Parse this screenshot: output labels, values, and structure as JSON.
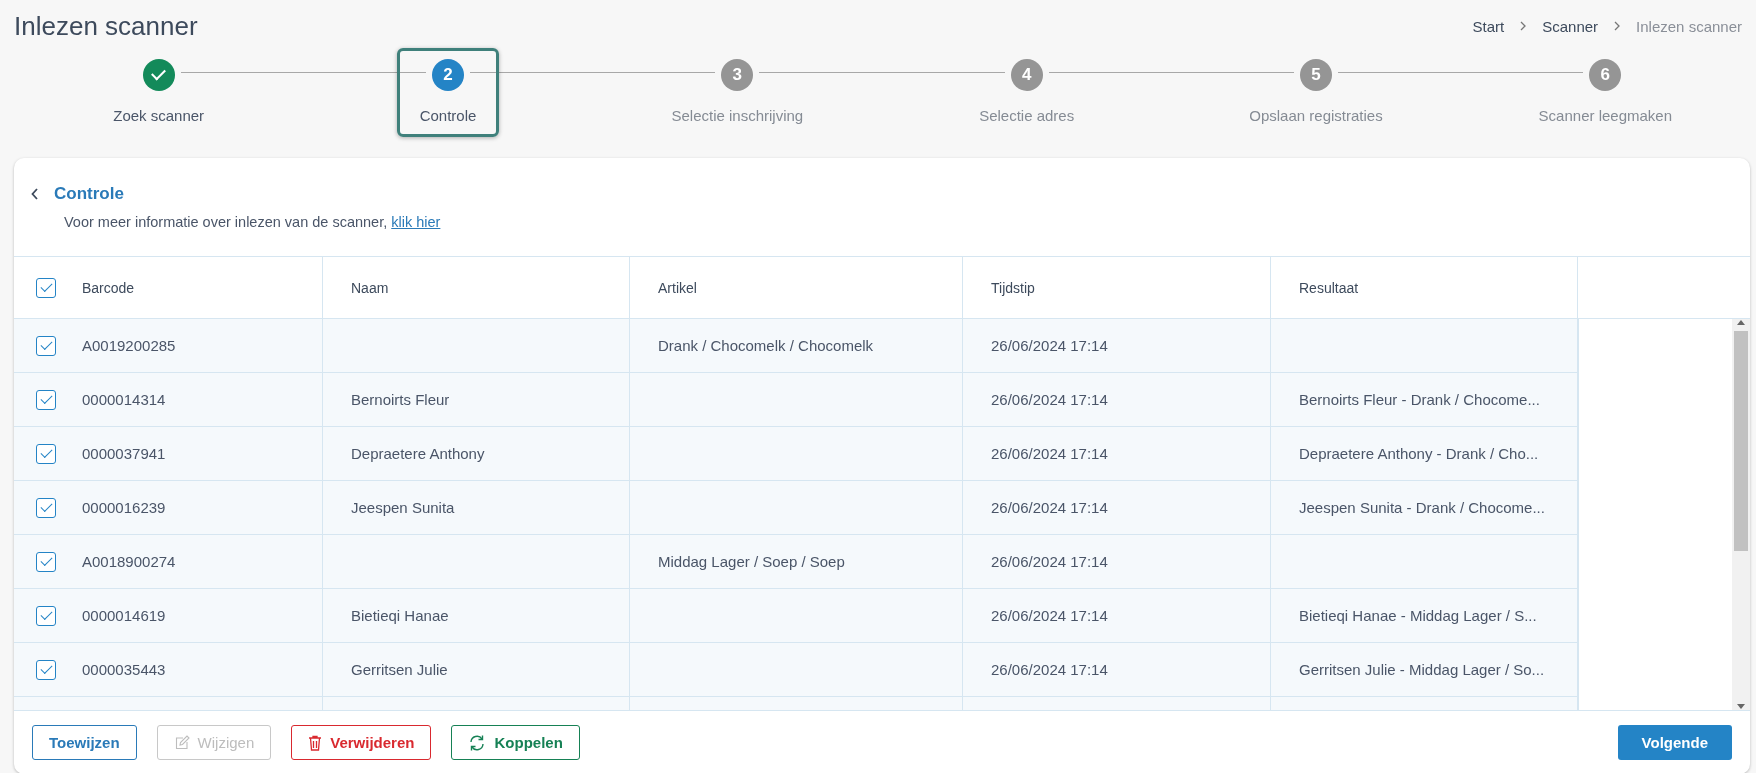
{
  "page": {
    "title": "Inlezen scanner"
  },
  "breadcrumb": [
    {
      "label": "Start",
      "current": false
    },
    {
      "label": "Scanner",
      "current": false
    },
    {
      "label": "Inlezen scanner",
      "current": true
    }
  ],
  "steps": [
    {
      "label": "Zoek scanner",
      "completed": true,
      "selected": false
    },
    {
      "label": "Controle",
      "number": "2",
      "completed": false,
      "selected": true
    },
    {
      "label": "Selectie inschrijving",
      "number": "3",
      "completed": false,
      "selected": false
    },
    {
      "label": "Selectie adres",
      "number": "4",
      "completed": false,
      "selected": false
    },
    {
      "label": "Opslaan registraties",
      "number": "5",
      "completed": false,
      "selected": false
    },
    {
      "label": "Scanner leegmaken",
      "number": "6",
      "completed": false,
      "selected": false
    }
  ],
  "card": {
    "title": "Controle",
    "info": "Voor meer informatie over inlezen van de scanner, ",
    "info_link": "klik hier"
  },
  "table": {
    "select_all_checked": true,
    "columns": [
      "Barcode",
      "Naam",
      "Artikel",
      "Tijdstip",
      "Resultaat"
    ],
    "rows": [
      {
        "checked": true,
        "cells": [
          "A0019200285",
          "",
          "Drank / Chocomelk / Chocomelk",
          "26/06/2024 17:14",
          ""
        ]
      },
      {
        "checked": true,
        "cells": [
          "0000014314",
          "Bernoirts Fleur",
          "",
          "26/06/2024 17:14",
          "Bernoirts Fleur - Drank / Chocome..."
        ]
      },
      {
        "checked": true,
        "cells": [
          "0000037941",
          "Depraetere Anthony",
          "",
          "26/06/2024 17:14",
          "Depraetere Anthony - Drank / Cho..."
        ]
      },
      {
        "checked": true,
        "cells": [
          "0000016239",
          "Jeespen Sunita",
          "",
          "26/06/2024 17:14",
          "Jeespen Sunita - Drank / Chocome..."
        ]
      },
      {
        "checked": true,
        "cells": [
          "A0018900274",
          "",
          "Middag Lager / Soep / Soep",
          "26/06/2024 17:14",
          ""
        ]
      },
      {
        "checked": true,
        "cells": [
          "0000014619",
          "Bietieqi Hanae",
          "",
          "26/06/2024 17:14",
          "Bietieqi Hanae - Middag Lager / S..."
        ]
      },
      {
        "checked": true,
        "cells": [
          "0000035443",
          "Gerritsen Julie",
          "",
          "26/06/2024 17:14",
          "Gerritsen Julie - Middag Lager / So..."
        ]
      }
    ]
  },
  "actions": [
    {
      "label": "Toewijzen",
      "kind": "outline",
      "disabled": false
    },
    {
      "label": "Wijzigen",
      "kind": "edit",
      "disabled": true
    },
    {
      "label": "Verwijderen",
      "kind": "delete",
      "disabled": false
    },
    {
      "label": "Koppelen",
      "kind": "link",
      "disabled": false
    }
  ],
  "next_button": {
    "label": "Volgende"
  }
}
